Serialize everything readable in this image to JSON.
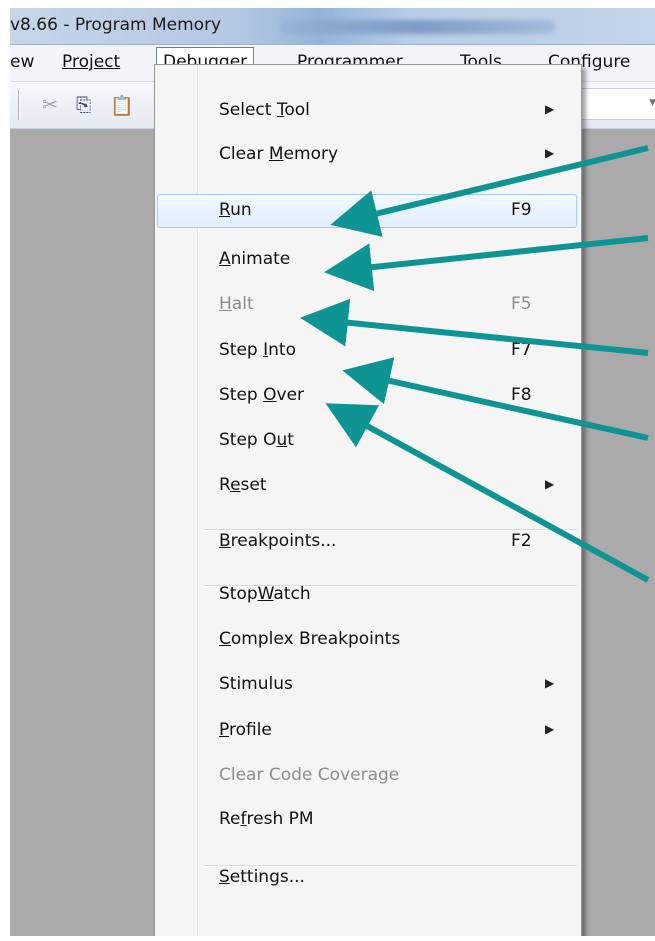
{
  "window": {
    "title": "v8.66 - Program Memory"
  },
  "menubar": {
    "items": [
      "ew",
      "Project",
      "Debugger",
      "Programmer",
      "Tools",
      "Configure"
    ],
    "active": "Debugger"
  },
  "toolbar": {
    "icons": [
      "cut-icon",
      "copy-icon",
      "paste-icon"
    ],
    "glyphs": [
      "✂",
      "⎘",
      "📋"
    ]
  },
  "debugger_menu": {
    "items": [
      {
        "label": "Select Tool",
        "submenu": true
      },
      {
        "label": "Clear Memory",
        "submenu": true
      },
      {
        "label": "Run",
        "shortcut": "F9",
        "highlighted": true
      },
      {
        "label": "Animate"
      },
      {
        "label": "Halt",
        "shortcut": "F5",
        "disabled": true
      },
      {
        "label": "Step Into",
        "shortcut": "F7"
      },
      {
        "label": "Step Over",
        "shortcut": "F8"
      },
      {
        "label": "Step Out"
      },
      {
        "label": "Reset",
        "submenu": true
      },
      {
        "label": "Breakpoints...",
        "shortcut": "F2"
      },
      {
        "label": "StopWatch"
      },
      {
        "label": "Complex Breakpoints"
      },
      {
        "label": "Stimulus",
        "submenu": true
      },
      {
        "label": "Profile",
        "submenu": true
      },
      {
        "label": "Clear Code Coverage",
        "disabled": true
      },
      {
        "label": "Refresh PM"
      },
      {
        "label": "Settings..."
      }
    ],
    "submenu_glyph": "▶"
  },
  "annotation": {
    "arrow_color": "#0e9493",
    "targets": [
      "Run",
      "Animate",
      "Halt",
      "Step Into",
      "Step Over"
    ]
  }
}
